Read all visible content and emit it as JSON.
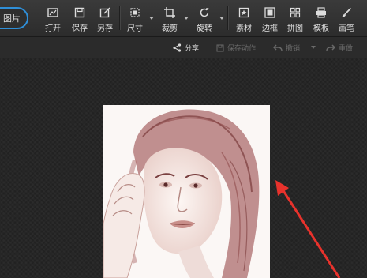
{
  "toolbar": {
    "open_image_label": "图片",
    "tools": [
      {
        "label": "打开",
        "icon": "open-image-icon"
      },
      {
        "label": "保存",
        "icon": "save-icon"
      },
      {
        "label": "另存",
        "icon": "save-as-icon"
      },
      {
        "label": "尺寸",
        "icon": "resize-icon"
      },
      {
        "label": "裁剪",
        "icon": "crop-icon"
      },
      {
        "label": "旋转",
        "icon": "rotate-icon"
      },
      {
        "label": "素材",
        "icon": "sticker-icon"
      },
      {
        "label": "边框",
        "icon": "border-icon"
      },
      {
        "label": "拼图",
        "icon": "collage-icon"
      },
      {
        "label": "模板",
        "icon": "template-icon"
      },
      {
        "label": "画笔",
        "icon": "brush-icon"
      }
    ]
  },
  "subbar": {
    "share_label": "分享",
    "save_action_label": "保存动作",
    "undo_label": "撤销",
    "redo_label": "重做"
  },
  "colors": {
    "accent": "#2f8fd8",
    "annotation_arrow": "#e8322c",
    "background": "#252525"
  }
}
